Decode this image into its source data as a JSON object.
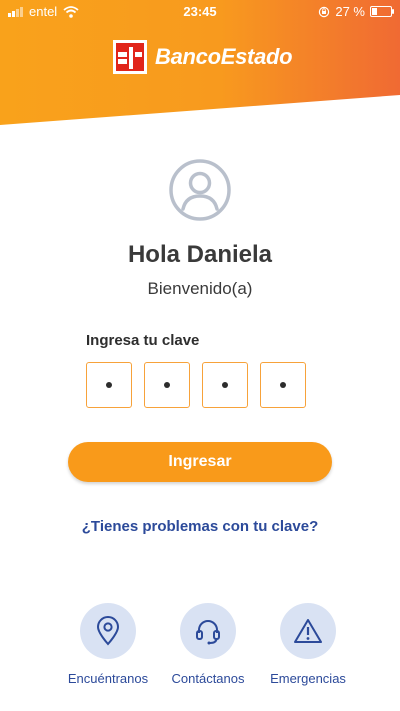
{
  "status_bar": {
    "carrier": "entel",
    "time": "23:45",
    "battery": "27 %",
    "battery_level": 0.27
  },
  "brand": {
    "name": "BancoEstado"
  },
  "user": {
    "greeting": "Hola Daniela",
    "welcome": "Bienvenido(a)"
  },
  "login": {
    "pin_label": "Ingresa tu clave",
    "pin_digits_filled": 4,
    "submit_label": "Ingresar",
    "help_link": "¿Tienes problemas con tu clave?"
  },
  "quick_actions": [
    {
      "label": "Encuéntranos",
      "icon": "location-pin-icon"
    },
    {
      "label": "Contáctanos",
      "icon": "headset-icon"
    },
    {
      "label": "Emergencias",
      "icon": "warning-icon"
    }
  ],
  "colors": {
    "accent_orange": "#f99a1a",
    "header_end": "#f06a33",
    "link_blue": "#2c4a9a",
    "icon_bg": "#d9e2f3",
    "pin_border": "#f7a23a"
  }
}
